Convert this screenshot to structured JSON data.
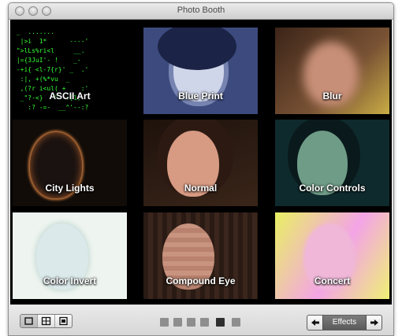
{
  "window": {
    "title": "Photo Booth"
  },
  "ascii_art_text": " _  .......\n  |>i  1*      ----'\n \">lLs%ri<l     __.\n |={3JuI'- !    _-\n -+i{ <l-7{r}' _  .'\n  :|, +(%*vu  _\n  ,(?r i<ul( +    :'\n  _\"?-<}   \"  :[1,\n    :? -=-  __^'--:?",
  "effects": [
    {
      "label": "ASCII Art"
    },
    {
      "label": "Blue Print"
    },
    {
      "label": "Blur"
    },
    {
      "label": "City Lights"
    },
    {
      "label": "Normal"
    },
    {
      "label": "Color Controls"
    },
    {
      "label": "Color Invert"
    },
    {
      "label": "Compound Eye"
    },
    {
      "label": "Concert"
    }
  ],
  "toolbar": {
    "view_buttons": [
      {
        "icon": "single-view-icon"
      },
      {
        "icon": "grid-view-icon"
      },
      {
        "icon": "filmstrip-view-icon"
      }
    ],
    "page_count": 6,
    "active_page": 5,
    "effects_label": "Effects",
    "prev_icon": "left-arrow-icon",
    "next_icon": "right-arrow-icon"
  }
}
